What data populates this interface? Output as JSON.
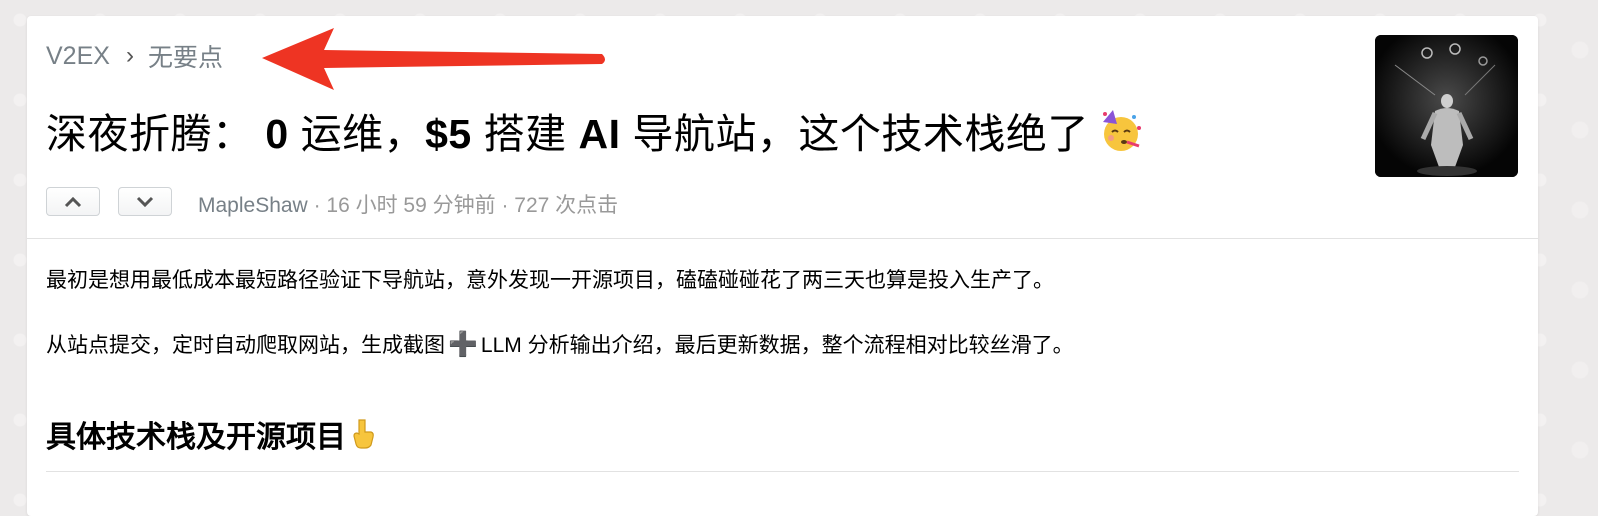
{
  "breadcrumb": {
    "site": "V2EX",
    "separator": "›",
    "node": "无要点"
  },
  "topic": {
    "title_part1": "深夜折腾： ",
    "title_part2": "0",
    "title_part3": " 运维，",
    "title_part4": "$5",
    "title_part5": " 搭建 ",
    "title_part6": "AI",
    "title_part7": " 导航站，这个技术栈绝了",
    "author": "MapleShaw",
    "meta_rest": " · 16 小时 59 分钟前 · 727 次点击"
  },
  "content": {
    "para1": "最初是想用最低成本最短路径验证下导航站，意外发现一开源项目，磕磕碰碰花了两三天也算是投入生产了。",
    "para2_a": "从站点提交，定时自动爬取网站，生成截图",
    "para2_plus": "➕",
    "para2_b": "LLM 分析输出介绍，最后更新数据，整个流程相对比较丝滑了。",
    "heading": "具体技术栈及开源项目"
  },
  "colors": {
    "arrow": "#ee3423",
    "link_gray": "#778087"
  },
  "icons": {
    "upvote": "chevron-up-icon",
    "downvote": "chevron-down-icon",
    "party": "partying-face-emoji",
    "point_down": "point-down-emoji"
  }
}
